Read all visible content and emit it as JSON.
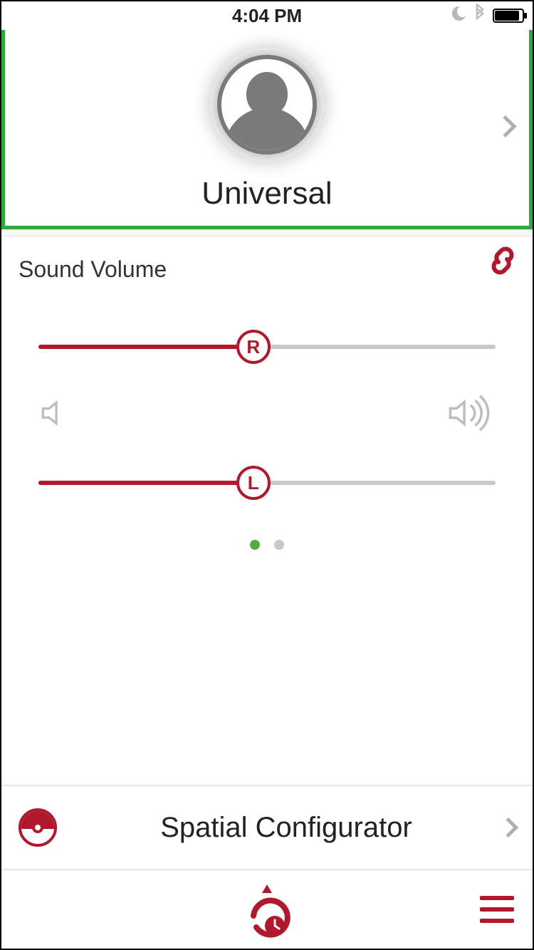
{
  "status_bar": {
    "time": "4:04 PM",
    "icons": {
      "moon": "moon-icon",
      "bluetooth": "bluetooth-icon",
      "battery": "battery-icon"
    }
  },
  "profile": {
    "name": "Universal",
    "avatar": "placeholder-silhouette"
  },
  "volume_section": {
    "title": "Sound Volume",
    "linked": true,
    "sliders": {
      "right": {
        "label": "R",
        "percent": 47
      },
      "left": {
        "label": "L",
        "percent": 47
      }
    },
    "icons": {
      "low": "speaker-mute-icon",
      "high": "speaker-loud-icon"
    }
  },
  "pagination": {
    "total": 2,
    "active_index": 0
  },
  "spatial_row": {
    "label": "Spatial Configurator",
    "icon": "spatial-icon"
  },
  "bottom_bar": {
    "center_icon": "recent-timer-icon",
    "menu_icon": "hamburger-menu-icon"
  },
  "colors": {
    "accent": "#b1182c",
    "green": "#2eaa3a"
  }
}
